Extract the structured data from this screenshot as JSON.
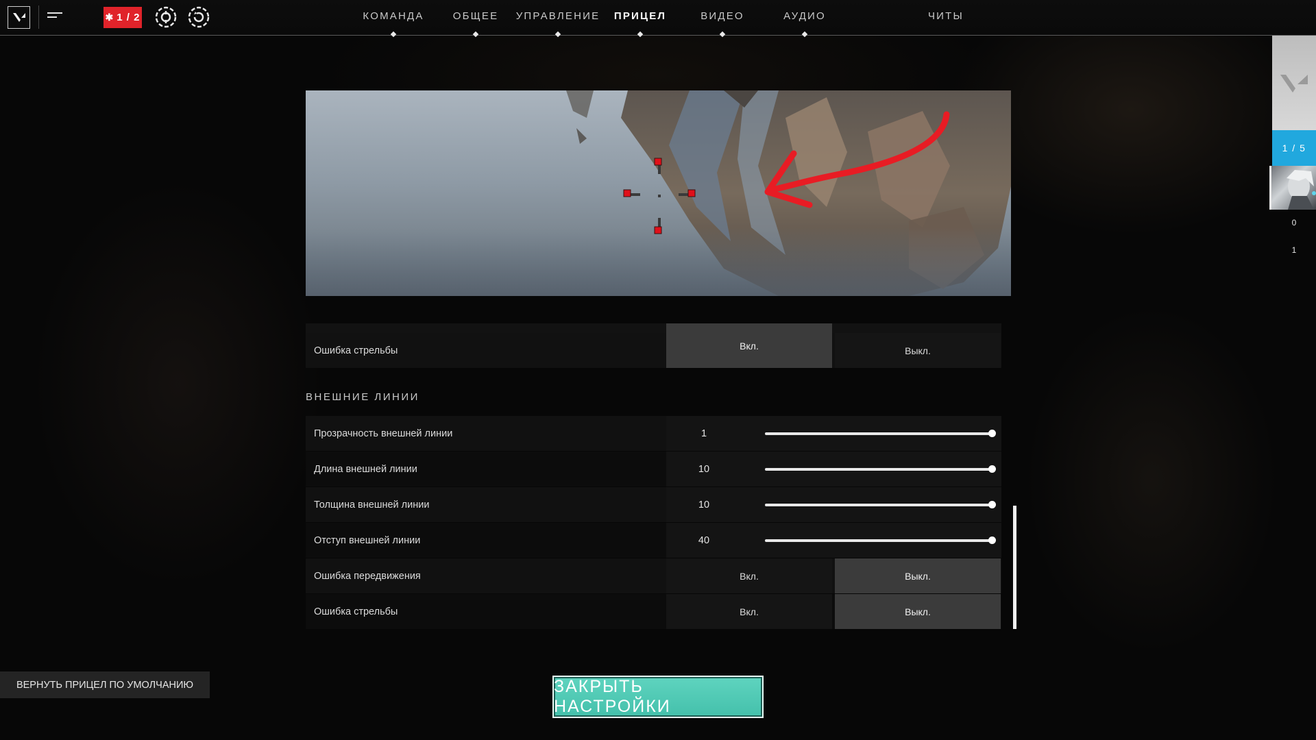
{
  "topbar": {
    "player_count_badge": "1 / 2",
    "nav": [
      {
        "label": "КОМАНДА",
        "active": false
      },
      {
        "label": "ОБЩЕЕ",
        "active": false
      },
      {
        "label": "УПРАВЛЕНИЕ",
        "active": false
      },
      {
        "label": "ПРИЦЕЛ",
        "active": true
      },
      {
        "label": "ВИДЕО",
        "active": false
      },
      {
        "label": "АУДИО",
        "active": false
      },
      {
        "label": "ЧИТЫ",
        "active": false
      }
    ]
  },
  "settings": {
    "firing_error_top": {
      "label": "Ошибка стрельбы",
      "on": "Вкл.",
      "off": "Выкл.",
      "selected": "on"
    },
    "outer_lines": {
      "title": "ВНЕШНИЕ ЛИНИИ",
      "opacity": {
        "label": "Прозрачность внешней линии",
        "value": "1",
        "fill": 1.0
      },
      "length": {
        "label": "Длина внешней линии",
        "value": "10",
        "fill": 1.0
      },
      "thickness": {
        "label": "Толщина внешней линии",
        "value": "10",
        "fill": 1.0
      },
      "offset": {
        "label": "Отступ внешней линии",
        "value": "40",
        "fill": 1.0
      },
      "movement_error": {
        "label": "Ошибка передвижения",
        "on": "Вкл.",
        "off": "Выкл.",
        "selected": "off"
      },
      "firing_error": {
        "label": "Ошибка стрельбы",
        "on": "Вкл.",
        "off": "Выкл.",
        "selected": "off"
      }
    }
  },
  "buttons": {
    "reset": "ВЕРНУТЬ ПРИЦЕЛ ПО УМОЛЧАНИЮ",
    "close": "ЗАКРЫТЬ НАСТРОЙКИ"
  },
  "right_panel": {
    "count": "1 / 5",
    "stat_1": "0",
    "stat_2": "1"
  },
  "colors": {
    "accent_teal": "#4cc6b1",
    "badge_red": "#e0232a",
    "panel_blue": "#21a8de",
    "crosshair_red": "#e0101a"
  }
}
